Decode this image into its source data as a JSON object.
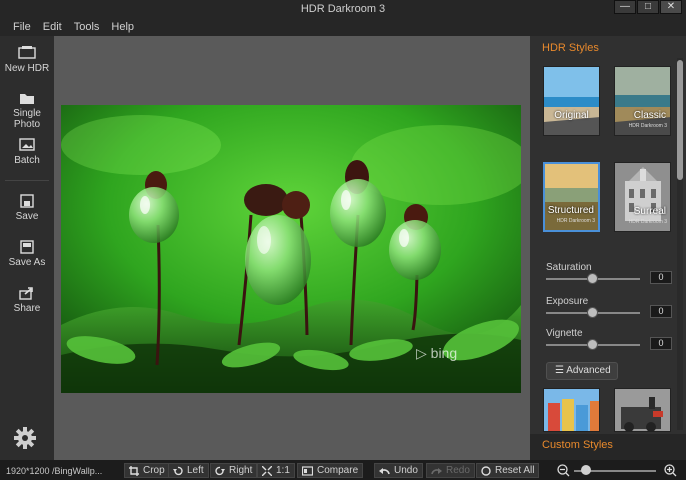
{
  "window": {
    "title": "HDR Darkroom 3",
    "controls": [
      "—",
      "□",
      "✕"
    ]
  },
  "menu": [
    "File",
    "Edit",
    "Tools",
    "Help"
  ],
  "sidebar": {
    "new_hdr": "New HDR",
    "single_photo": "Single Photo",
    "batch": "Batch",
    "save": "Save",
    "save_as": "Save As",
    "share": "Share"
  },
  "canvas": {
    "watermark": "bing"
  },
  "panel": {
    "title": "HDR Styles",
    "styles": [
      {
        "label": "Original",
        "sub": ""
      },
      {
        "label": "Classic",
        "sub": "HDR Darkroom 3"
      },
      {
        "label": "Structured",
        "sub": "HDR Darkroom 3"
      },
      {
        "label": "Surreal",
        "sub": "HDR Darkroom 3"
      }
    ],
    "sliders": [
      {
        "label": "Saturation",
        "value": "0",
        "level": 0.5
      },
      {
        "label": "Exposure",
        "value": "0",
        "level": 0.5
      },
      {
        "label": "Vignette",
        "value": "0",
        "level": 0.5
      }
    ],
    "advanced_label": "Advanced",
    "custom_title": "Custom Styles"
  },
  "status": {
    "file_info": "1920*1200 /BingWallp...",
    "crop": "Crop",
    "left": "Left",
    "right": "Right",
    "one_to_one": "1:1",
    "compare": "Compare",
    "undo": "Undo",
    "redo": "Redo",
    "reset_all": "Reset All",
    "zoom_level": 0.15
  },
  "colors": {
    "accent": "#e8892c",
    "selection": "#4a90d9"
  }
}
